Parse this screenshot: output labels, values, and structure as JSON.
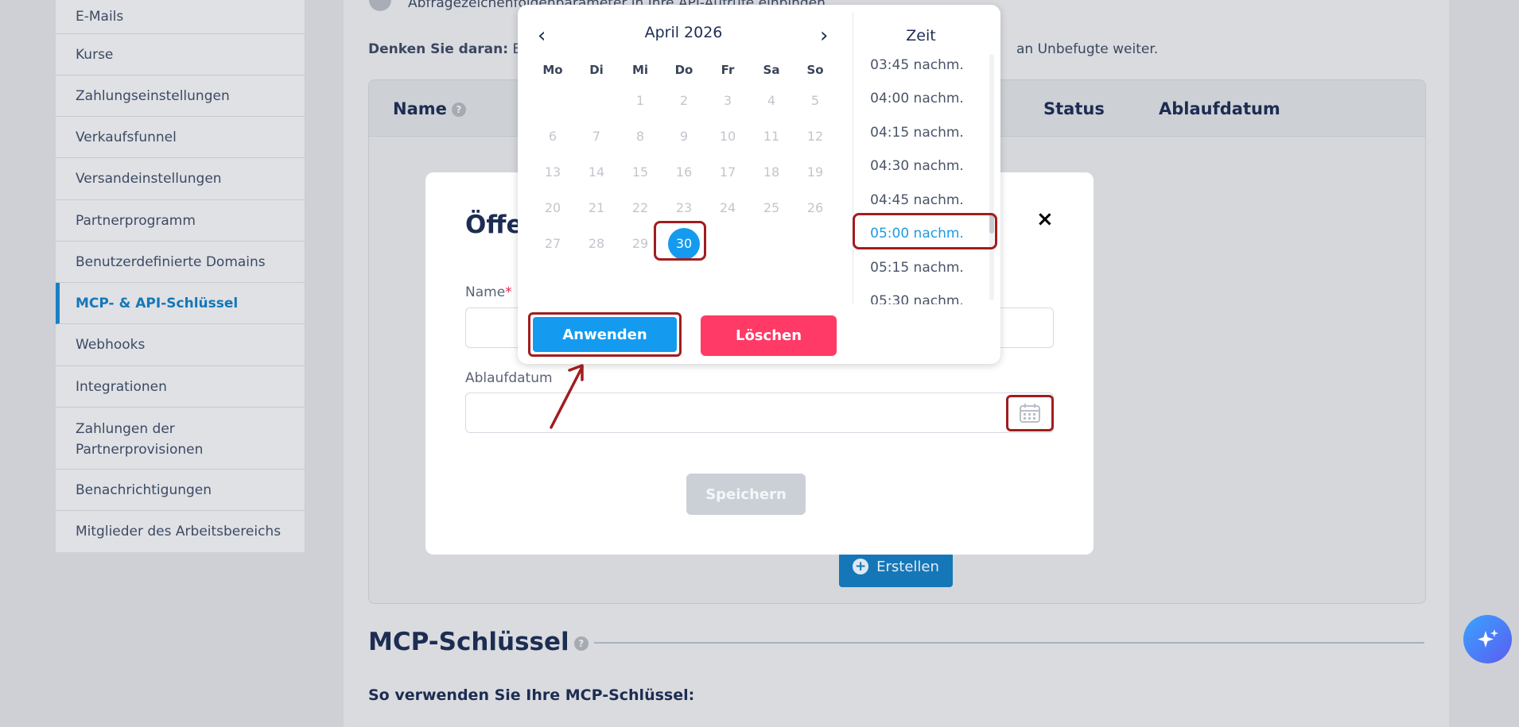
{
  "sidebar": {
    "items": [
      {
        "label": "E-Mails"
      },
      {
        "label": "Kurse"
      },
      {
        "label": "Zahlungseinstellungen"
      },
      {
        "label": "Verkaufsfunnel"
      },
      {
        "label": "Versandeinstellungen"
      },
      {
        "label": "Partnerprogramm"
      },
      {
        "label": "Benutzerdefinierte Domains"
      },
      {
        "label": "MCP- & API-Schlüssel",
        "active": true
      },
      {
        "label": "Webhooks"
      },
      {
        "label": "Integrationen"
      },
      {
        "label": "Zahlungen der Partnerprovisionen"
      },
      {
        "label": "Benachrichtigungen"
      },
      {
        "label": "Mitglieder des Arbeitsbereichs"
      }
    ]
  },
  "main": {
    "top_partial_text": "Abfragezeichenfolgenparameter in Ihre API-Aufrufe einbinden",
    "reminder_bold": "Denken Sie daran:",
    "reminder_left": "Bew",
    "reminder_right": "an Unbefugte weiter.",
    "table_headers": {
      "name": "Name",
      "status": "Status",
      "expiry": "Ablaufdatum"
    },
    "create_button": "Erstellen",
    "mcp_title": "MCP-Schlüssel",
    "mcp_subtitle": "So verwenden Sie Ihre MCP-Schlüssel:"
  },
  "modal": {
    "title_partial": "Öffen",
    "close_label": "×",
    "name_label": "Name",
    "required_marker": "*",
    "expiry_label": "Ablaufdatum",
    "save_button": "Speichern"
  },
  "datepicker": {
    "month_label": "April 2026",
    "prev_label": "‹",
    "next_label": "›",
    "weekdays": [
      "Mo",
      "Di",
      "Mi",
      "Do",
      "Fr",
      "Sa",
      "So"
    ],
    "days": [
      "1",
      "2",
      "3",
      "4",
      "5",
      "6",
      "7",
      "8",
      "9",
      "10",
      "11",
      "12",
      "13",
      "14",
      "15",
      "16",
      "17",
      "18",
      "19",
      "20",
      "21",
      "22",
      "23",
      "24",
      "25",
      "26",
      "27",
      "28",
      "29",
      "30"
    ],
    "selected_day": "30",
    "time_header": "Zeit",
    "times": [
      "03:45 nachm.",
      "04:00 nachm.",
      "04:15 nachm.",
      "04:30 nachm.",
      "04:45 nachm.",
      "05:00 nachm.",
      "05:15 nachm.",
      "05:30 nachm."
    ],
    "selected_time": "05:00 nachm.",
    "apply_button": "Anwenden",
    "delete_button": "Löschen"
  },
  "colors": {
    "accent_blue": "#149bf0",
    "brand_blue": "#1577b8",
    "delete_red": "#ff3a66",
    "highlight_red": "#a11d1f"
  }
}
